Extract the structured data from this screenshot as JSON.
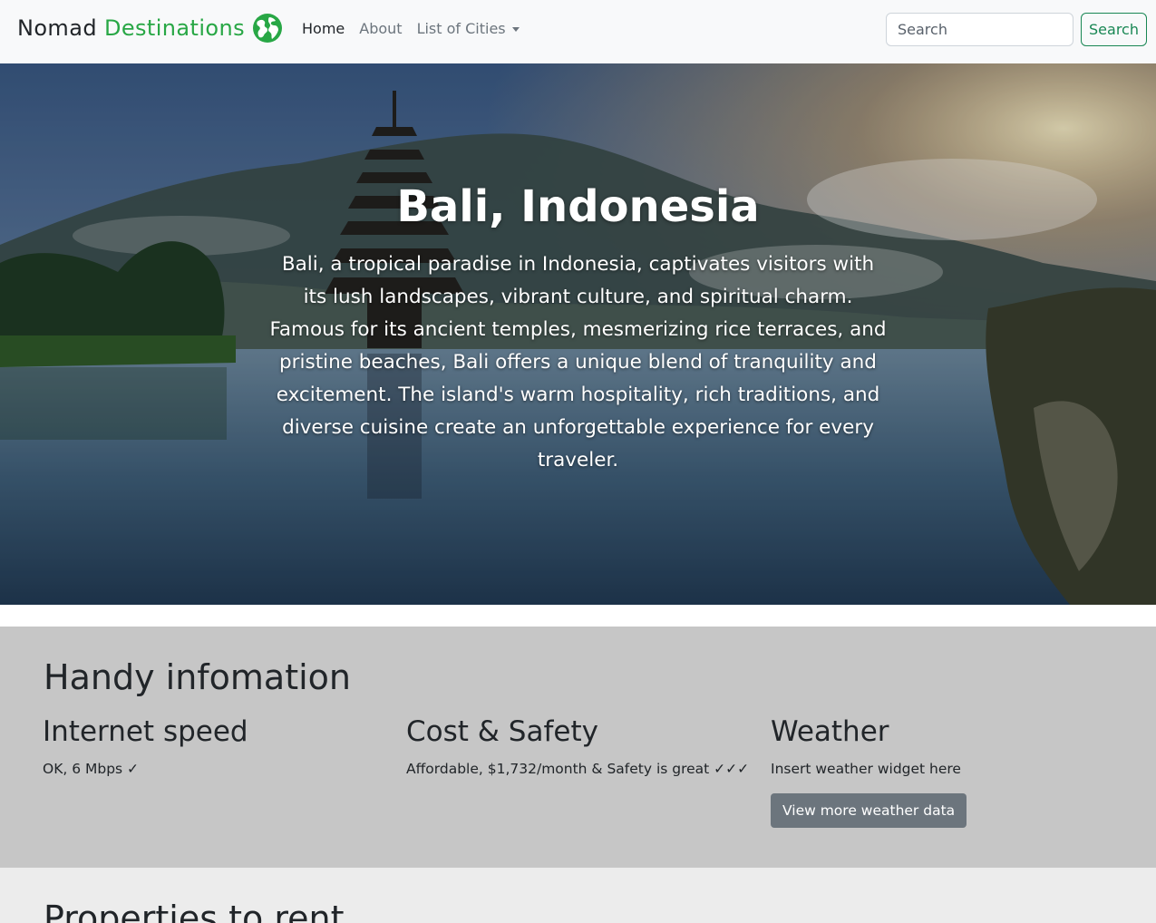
{
  "navbar": {
    "brand_part1": "Nomad",
    "brand_part2": "Destinations",
    "brand_icon": "globe-icon",
    "links": [
      "Home",
      "About",
      "List of Cities"
    ],
    "search_placeholder": "Search",
    "search_button": "Search",
    "colors": {
      "brand_accent": "#28a745",
      "search_button": "#198754",
      "background": "#f8f9fa"
    }
  },
  "hero": {
    "title": "Bali, Indonesia",
    "description": "Bali, a tropical paradise in Indonesia, captivates visitors with its lush landscapes, vibrant culture, and spiritual charm. Famous for its ancient temples, mesmerizing rice terraces, and pristine beaches, Bali offers a unique blend of tranquility and excitement. The island's warm hospitality, rich traditions, and diverse cuisine create an unforgettable experience for every traveler."
  },
  "handy_info": {
    "heading": "Handy infomation",
    "internet": {
      "title": "Internet speed",
      "text": "OK, 6 Mbps ✓"
    },
    "cost_safety": {
      "title": "Cost & Safety",
      "text": "Affordable, $1,732/month & Safety is great ✓✓✓"
    },
    "weather": {
      "title": "Weather",
      "text": "Insert weather widget here",
      "button": "View more weather data"
    },
    "colors": {
      "background": "#c6c6c6",
      "button": "#6c757d"
    }
  },
  "properties": {
    "heading": "Properties to rent"
  }
}
